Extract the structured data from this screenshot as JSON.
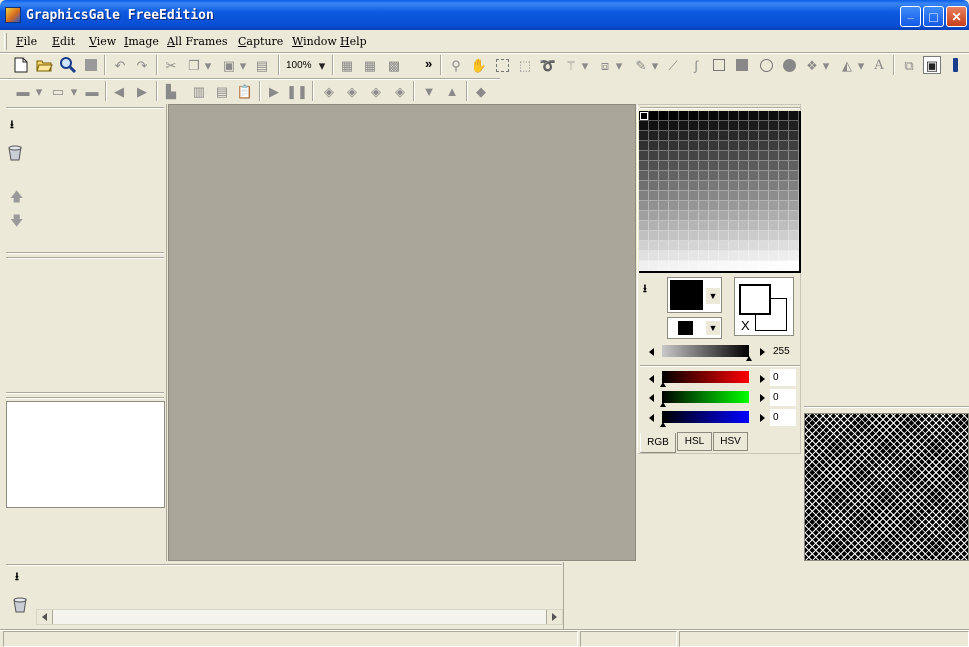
{
  "window": {
    "title": "GraphicsGale FreeEdition",
    "controls": {
      "minimize": "_",
      "maximize": "□",
      "close": "✕"
    }
  },
  "menu": [
    "File",
    "Edit",
    "View",
    "Image",
    "All Frames",
    "Capture",
    "Window",
    "Help"
  ],
  "toolbar": {
    "zoom_value": "100%",
    "overflow": "»"
  },
  "color": {
    "brightness_value": "255",
    "r_value": "0",
    "g_value": "0",
    "b_value": "0",
    "transparent_mark": "X",
    "foreground": "#000000",
    "background": "#ffffff"
  },
  "color_tabs": [
    "RGB",
    "HSL",
    "HSV"
  ],
  "colors": {
    "title_bar": "#0a5ee8",
    "face": "#ece9d8",
    "canvas": "#aaa69a",
    "red_slider": "#ff0000",
    "green_slider": "#00ff00",
    "blue_slider": "#0000ff"
  },
  "icons": {
    "file": [
      "new-file-icon",
      "open-folder-icon",
      "zoom-preview-icon",
      "stop-icon",
      "undo-icon",
      "redo-icon",
      "cut-icon",
      "copy-icon",
      "paste-icon",
      "paste-new-icon"
    ],
    "draw": [
      "magnifier-icon",
      "hand-icon",
      "rect-select-icon",
      "lasso-icon",
      "rope-icon",
      "magic-wand-icon",
      "move-icon",
      "pencil-icon",
      "line-icon",
      "curve-icon",
      "rectangle-icon",
      "filled-rectangle-icon",
      "ellipse-icon",
      "filled-ellipse-icon",
      "spray-icon",
      "fill-icon",
      "text-icon"
    ]
  }
}
